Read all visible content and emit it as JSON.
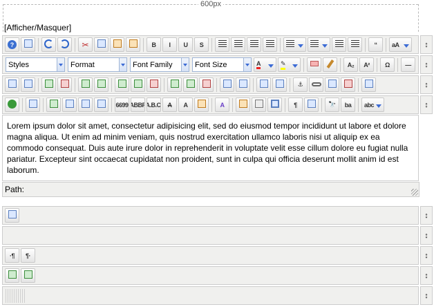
{
  "ruler": {
    "label": "600px"
  },
  "toggle": {
    "label": "[Afficher/Masquer]"
  },
  "toolbar1": [
    {
      "name": "help-icon"
    },
    {
      "name": "new-document-icon"
    },
    {
      "sep": true
    },
    {
      "name": "undo-icon"
    },
    {
      "name": "redo-icon"
    },
    {
      "sep": true
    },
    {
      "name": "cut-icon"
    },
    {
      "name": "copy-icon"
    },
    {
      "name": "paste-icon"
    },
    {
      "name": "paste-text-icon"
    },
    {
      "sep": true
    },
    {
      "name": "bold-icon",
      "glyph": "B"
    },
    {
      "name": "italic-icon",
      "glyph": "I"
    },
    {
      "name": "underline-icon",
      "glyph": "U"
    },
    {
      "name": "strikethrough-icon",
      "glyph": "S"
    },
    {
      "sep": true
    },
    {
      "name": "align-justify-icon"
    },
    {
      "name": "align-left-icon"
    },
    {
      "name": "align-center-icon"
    },
    {
      "name": "align-right-icon"
    },
    {
      "sep": true
    },
    {
      "name": "numbered-list-icon",
      "wide": true
    },
    {
      "name": "bullet-list-icon",
      "wide": true
    },
    {
      "name": "outdent-icon"
    },
    {
      "name": "indent-icon"
    },
    {
      "sep": true
    },
    {
      "name": "blockquote-icon",
      "glyph": "“"
    },
    {
      "sep": true
    },
    {
      "name": "text-case-icon",
      "wide": true,
      "glyph": "aA"
    }
  ],
  "toolbar2": {
    "selects": [
      {
        "name": "styles-select",
        "value": "Styles"
      },
      {
        "name": "format-select",
        "value": "Format"
      },
      {
        "name": "font-family-select",
        "value": "Font Family"
      },
      {
        "name": "font-size-select",
        "value": "Font Size"
      }
    ],
    "buttons": [
      {
        "name": "text-color-icon",
        "wide": true,
        "glyph": "A"
      },
      {
        "name": "highlight-color-icon",
        "wide": true,
        "glyph": "✎"
      },
      {
        "sep": true
      },
      {
        "name": "eraser-icon"
      },
      {
        "name": "clean-brush-icon"
      },
      {
        "sep": true
      },
      {
        "name": "subscript-icon",
        "glyph": "A₂"
      },
      {
        "name": "superscript-icon",
        "glyph": "A²"
      },
      {
        "sep": true
      },
      {
        "name": "special-char-icon",
        "glyph": "Ω"
      },
      {
        "sep": true
      },
      {
        "name": "horizontal-rule-icon",
        "glyph": "—"
      }
    ]
  },
  "toolbar3": [
    {
      "name": "table-icon"
    },
    {
      "name": "table-cell-icon"
    },
    {
      "sep": true
    },
    {
      "name": "edit-row-icon"
    },
    {
      "name": "delete-row-icon"
    },
    {
      "sep": true
    },
    {
      "name": "row-before-icon"
    },
    {
      "name": "row-after-icon"
    },
    {
      "sep": true
    },
    {
      "name": "insert-row-before-icon"
    },
    {
      "name": "insert-row-after-icon"
    },
    {
      "name": "delete-table-row-icon"
    },
    {
      "sep": true
    },
    {
      "name": "insert-col-before-icon"
    },
    {
      "name": "insert-col-after-icon"
    },
    {
      "name": "delete-col-icon"
    },
    {
      "sep": true
    },
    {
      "name": "split-cells-icon"
    },
    {
      "name": "merge-cells-icon"
    },
    {
      "sep": true
    },
    {
      "name": "layer-icon"
    },
    {
      "name": "frame-icon"
    },
    {
      "sep": true
    },
    {
      "name": "anchor-icon",
      "glyph": "⚓"
    },
    {
      "name": "link-icon"
    },
    {
      "name": "image-icon"
    },
    {
      "name": "unlink-icon"
    },
    {
      "sep": true
    },
    {
      "name": "media-icon"
    }
  ],
  "toolbar4": [
    {
      "name": "history-icon"
    },
    {
      "sep": true
    },
    {
      "name": "source-code-icon"
    },
    {
      "sep": true
    },
    {
      "name": "insert-layer-icon"
    },
    {
      "name": "move-forward-icon"
    },
    {
      "name": "move-backward-icon"
    },
    {
      "name": "absolute-position-icon"
    },
    {
      "sep": true
    },
    {
      "name": "cite-icon",
      "glyph": "6699"
    },
    {
      "name": "abbr-icon",
      "glyph": "ABBR"
    },
    {
      "name": "acronym-icon",
      "glyph": "A.B.C."
    },
    {
      "name": "deletion-icon",
      "glyph": "A"
    },
    {
      "name": "insertion-icon",
      "glyph": "A"
    },
    {
      "name": "attributes-icon"
    },
    {
      "sep": true
    },
    {
      "name": "style-props-icon",
      "glyph": "A"
    },
    {
      "sep": true
    },
    {
      "name": "template-icon"
    },
    {
      "name": "print-icon"
    },
    {
      "name": "fullscreen-icon"
    },
    {
      "sep": true
    },
    {
      "name": "show-blocks-icon",
      "glyph": "¶"
    },
    {
      "name": "non-breaking-icon"
    },
    {
      "sep": true
    },
    {
      "name": "search-icon",
      "glyph": "🔭"
    },
    {
      "name": "replace-icon",
      "glyph": "ba"
    },
    {
      "sep": true
    },
    {
      "name": "spellcheck-icon",
      "wide": true,
      "glyph": "abc"
    }
  ],
  "editor": {
    "content": "Lorem ipsum dolor sit amet, consectetur adipisicing elit, sed do eiusmod tempor incididunt ut labore et dolore magna aliqua. Ut enim ad minim veniam, quis nostrud exercitation ullamco laboris nisi ut aliquip ex ea commodo consequat. Duis aute irure dolor in reprehenderit in voluptate velit esse cillum dolore eu fugiat nulla pariatur. Excepteur sint occaecat cupidatat non proident, sunt in culpa qui officia deserunt mollit anim id est laborum."
  },
  "statusbar": {
    "path_label": "Path:"
  },
  "extra_rows": [
    [
      {
        "name": "table-props-icon"
      }
    ],
    [],
    [
      {
        "name": "ltr-icon",
        "glyph": "·¶"
      },
      {
        "name": "rtl-icon",
        "glyph": "¶·"
      }
    ],
    [
      {
        "name": "insert-image-left-icon"
      },
      {
        "name": "insert-image-right-icon"
      }
    ],
    []
  ],
  "handle_glyph": "↕"
}
